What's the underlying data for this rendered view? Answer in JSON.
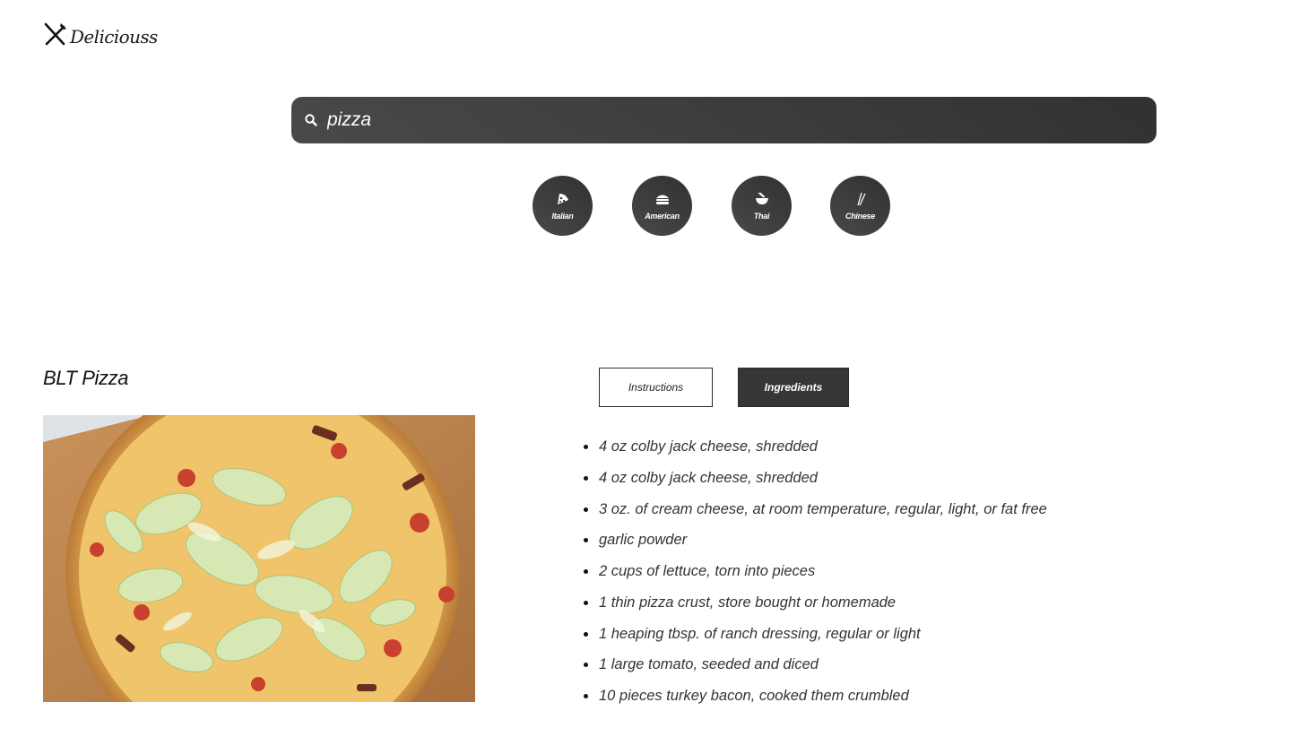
{
  "header": {
    "logo_text": "Deliciouss",
    "logo_icon": "fork-knife-icon"
  },
  "search": {
    "value": "pizza",
    "icon": "search-icon"
  },
  "cuisines": [
    {
      "label": "Italian",
      "icon": "pizza-slice-icon"
    },
    {
      "label": "American",
      "icon": "hamburger-icon"
    },
    {
      "label": "Thai",
      "icon": "noodle-bowl-icon"
    },
    {
      "label": "Chinese",
      "icon": "chopsticks-icon"
    }
  ],
  "recipe": {
    "title": "BLT Pizza",
    "tabs": {
      "instructions": "Instructions",
      "ingredients": "Ingredients",
      "active": "ingredients"
    },
    "ingredients": [
      "4 oz colby jack cheese, shredded",
      "4 oz colby jack cheese, shredded",
      "3 oz. of cream cheese, at room temperature, regular, light, or fat free",
      "garlic powder",
      "2 cups of lettuce, torn into pieces",
      "1 thin pizza crust, store bought or homemade",
      "1 heaping tbsp. of ranch dressing, regular or light",
      "1 large tomato, seeded and diced",
      "10 pieces turkey bacon, cooked them crumbled"
    ]
  },
  "colors": {
    "dark_gradient_start": "#494949",
    "dark_gradient_end": "#313131",
    "active_tab": "#363636",
    "background": "#ffffff"
  }
}
